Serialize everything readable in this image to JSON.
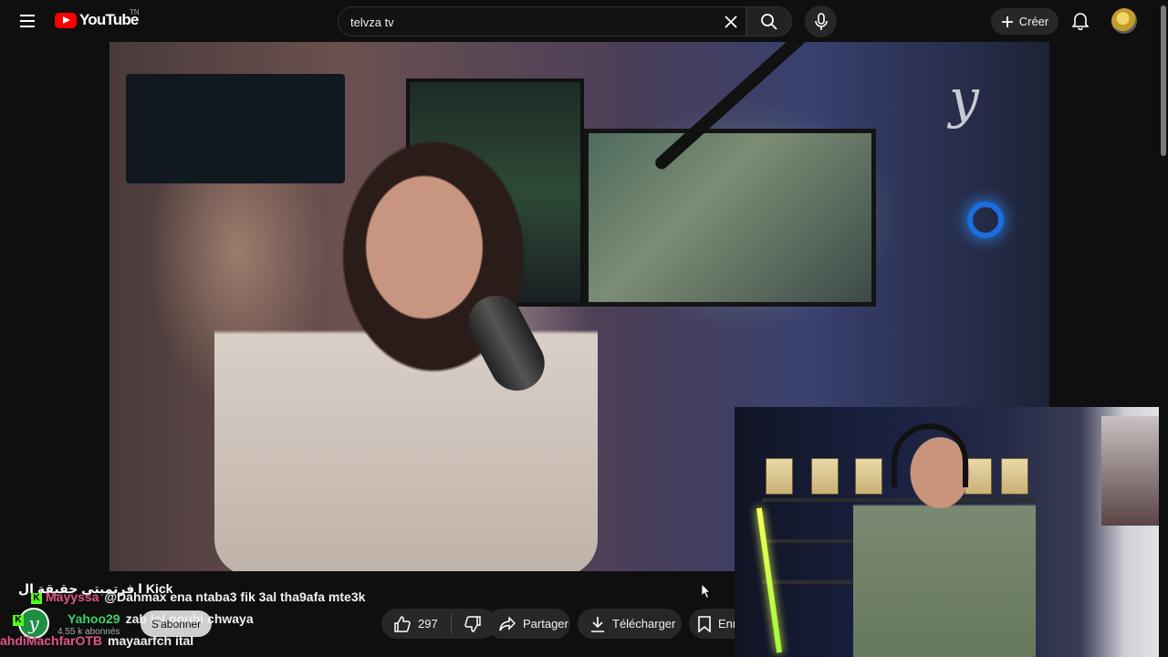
{
  "header": {
    "logo_text": "YouTube",
    "country_code": "TN",
    "search_value": "telvza tv",
    "create_label": "Créer"
  },
  "overlay": {
    "kick_title": "Kick ا فرتمبتی حقیقة ال",
    "chat": [
      {
        "user": "Mayyssa",
        "user_color": "#e0548a",
        "message": "@Dahmax ena ntaba3 fik 3al tha9afa mte3k"
      },
      {
        "user": "Yahoo29",
        "user_color": "#3fd06b",
        "message": "zab lol goubi chwaya"
      },
      {
        "user": "ahdiMachfarOTB",
        "user_color": "#e0548a",
        "message": "mayaarfch ital"
      }
    ]
  },
  "channel": {
    "avatar_letter": "y",
    "subscribers": "4.55 k abonnés",
    "subscribe_label": "S'abonner"
  },
  "actions": {
    "like_count": "297",
    "share_label": "Partager",
    "download_label": "Télécharger",
    "save_label": "Enr"
  },
  "video": {
    "watermark": "y"
  },
  "colors": {
    "background": "#0f0f0f",
    "brand_red": "#ff0000",
    "kick_green": "#53fc18",
    "pill_bg": "#272727"
  }
}
